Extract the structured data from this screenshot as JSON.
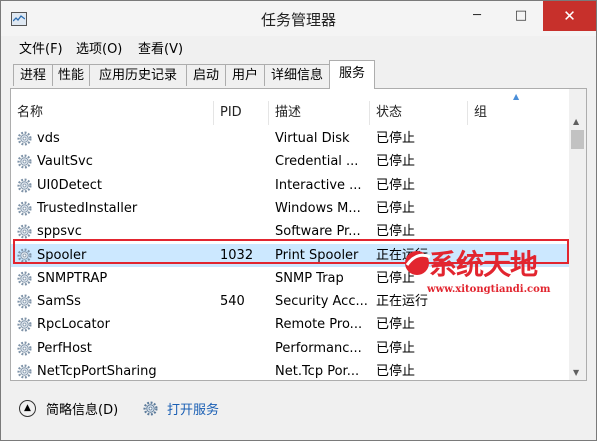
{
  "window": {
    "title": "任务管理器"
  },
  "menu": [
    "文件(F)",
    "选项(O)",
    "查看(V)"
  ],
  "tabs": [
    "进程",
    "性能",
    "应用历史记录",
    "启动",
    "用户",
    "详细信息",
    "服务"
  ],
  "active_tab": "服务",
  "columns": [
    "名称",
    "PID",
    "描述",
    "状态",
    "组"
  ],
  "services": [
    {
      "name": "vds",
      "pid": "",
      "desc": "Virtual Disk",
      "status": "已停止"
    },
    {
      "name": "VaultSvc",
      "pid": "",
      "desc": "Credential ...",
      "status": "已停止"
    },
    {
      "name": "UI0Detect",
      "pid": "",
      "desc": "Interactive ...",
      "status": "已停止"
    },
    {
      "name": "TrustedInstaller",
      "pid": "",
      "desc": "Windows M...",
      "status": "已停止"
    },
    {
      "name": "sppsvc",
      "pid": "",
      "desc": "Software Pr...",
      "status": "已停止"
    },
    {
      "name": "Spooler",
      "pid": "1032",
      "desc": "Print Spooler",
      "status": "正在运行"
    },
    {
      "name": "SNMPTRAP",
      "pid": "",
      "desc": "SNMP Trap",
      "status": "已停止"
    },
    {
      "name": "SamSs",
      "pid": "540",
      "desc": "Security Acc...",
      "status": "正在运行"
    },
    {
      "name": "RpcLocator",
      "pid": "",
      "desc": "Remote Pro...",
      "status": "已停止"
    },
    {
      "name": "PerfHost",
      "pid": "",
      "desc": "Performanc...",
      "status": "已停止"
    },
    {
      "name": "NetTcpPortSharing",
      "pid": "",
      "desc": "Net.Tcp Por...",
      "status": "已停止"
    }
  ],
  "selected_service": "Spooler",
  "footer": {
    "details_label": "简略信息(D)",
    "open_services_label": "打开服务"
  },
  "watermark": {
    "title": "系统天地",
    "url": "www.xitongtiandi.com"
  },
  "colors": {
    "selection": "#cce8ff",
    "highlight_border": "#e2252f",
    "link": "#1a5fb4",
    "close_button": "#c7302b"
  }
}
